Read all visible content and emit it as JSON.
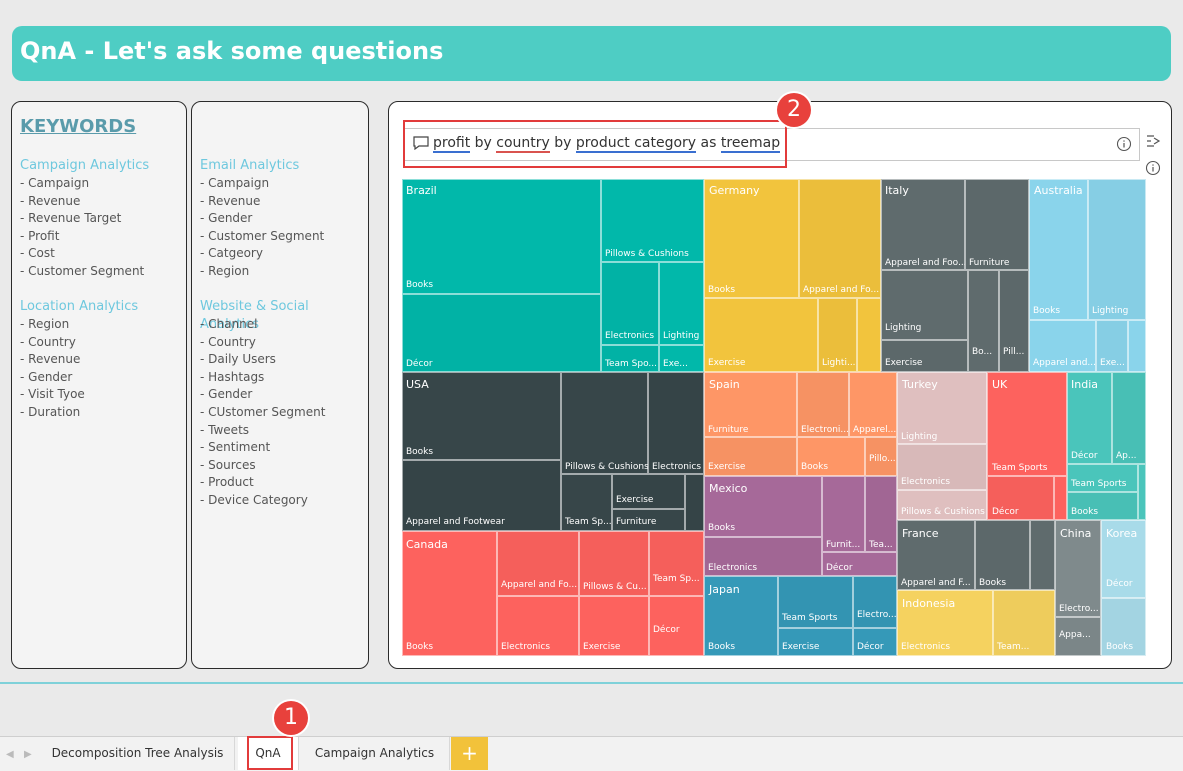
{
  "title": "QnA - Let's ask some questions",
  "keywords_heading": "KEYWORDS",
  "left_groups": [
    {
      "title": "Campaign Analytics",
      "items": [
        "- Campaign",
        "- Revenue",
        "- Revenue Target",
        "- Profit",
        "- Cost",
        "- Customer Segment"
      ]
    },
    {
      "title": "Location Analytics",
      "items": [
        "- Region",
        "- Country",
        "- Revenue",
        "- Gender",
        "- Visit Tyoe",
        "- Duration"
      ]
    }
  ],
  "mid_groups": [
    {
      "title": "Email Analytics",
      "items": [
        "- Campaign",
        "- Revenue",
        "- Gender",
        "- Customer Segment",
        "- Catgeory",
        "- Region"
      ]
    },
    {
      "title": "Website & Social Analytics",
      "items": [
        "- Channel",
        "- Country",
        "- Daily Users",
        "- Hashtags",
        "- Gender",
        "- CUstomer Segment",
        "- Tweets",
        "- Sentiment",
        "- Sources",
        "- Product",
        "- Device Category"
      ]
    }
  ],
  "qna": {
    "words": [
      {
        "t": "profit",
        "u": "blue"
      },
      {
        "t": " by ",
        "u": ""
      },
      {
        "t": "country",
        "u": "red"
      },
      {
        "t": " by ",
        "u": ""
      },
      {
        "t": "product category",
        "u": "blue"
      },
      {
        "t": " as ",
        "u": ""
      },
      {
        "t": "treemap",
        "u": "blue"
      }
    ]
  },
  "badges": {
    "b1": "1",
    "b2": "2"
  },
  "tabs": {
    "decomp": "Decomposition Tree Analysis",
    "qna": "QnA",
    "campaign": "Campaign Analytics",
    "add": "+"
  },
  "colors": {
    "title_bar": "#4ecdc4",
    "badge": "#e8413c",
    "add_tab": "#f2c23a"
  },
  "chart_data": {
    "type": "treemap",
    "hierarchy": [
      "country",
      "product category"
    ],
    "measure": "profit",
    "countries": [
      {
        "name": "Brazil",
        "color": "#01b8aa",
        "labels": [
          "Books",
          "Décor",
          "Pillows & Cushions",
          "Electronics",
          "Lighting",
          "Team Spo...",
          "Exe..."
        ]
      },
      {
        "name": "Germany",
        "color": "#f2c43d",
        "labels": [
          "Books",
          "Apparel and Fo...",
          "Exercise",
          "Lighti..."
        ]
      },
      {
        "name": "Italy",
        "color": "#5f6b6d",
        "labels": [
          "Apparel and Foo...",
          "Furniture",
          "Lighting",
          "Exercise",
          "Bo...",
          "Pill..."
        ]
      },
      {
        "name": "Australia",
        "color": "#8ad4eb",
        "labels": [
          "Books",
          "Lighting",
          "Apparel and...",
          "Exe..."
        ]
      },
      {
        "name": "USA",
        "color": "#374649",
        "labels": [
          "Books",
          "Apparel and Footwear",
          "Pillows & Cushions",
          "Electronics",
          "Exercise",
          "Team Sp...",
          "Furniture"
        ]
      },
      {
        "name": "Spain",
        "color": "#fe9666",
        "labels": [
          "Furniture",
          "Electroni...",
          "Apparel...",
          "Exercise",
          "Books",
          "Pillo..."
        ]
      },
      {
        "name": "Turkey",
        "color": "#dfbfbf",
        "labels": [
          "Lighting",
          "Electronics",
          "Pillows & Cushions"
        ]
      },
      {
        "name": "UK",
        "color": "#fd625e",
        "labels": [
          "Team Sports",
          "Décor"
        ]
      },
      {
        "name": "India",
        "color": "#4ac5bb",
        "labels": [
          "Décor",
          "Ap...",
          "Team Sports",
          "Books"
        ]
      },
      {
        "name": "Mexico",
        "color": "#a66999",
        "labels": [
          "Books",
          "Electronics",
          "Furnit...",
          "Tea...",
          "Décor"
        ]
      },
      {
        "name": "France",
        "color": "#5f6b6d",
        "labels": [
          "Apparel and F...",
          "Books"
        ]
      },
      {
        "name": "China",
        "color": "#7f8a8c",
        "labels": [
          "Electro...",
          "Appa..."
        ]
      },
      {
        "name": "Korea",
        "color": "#a8dbe9",
        "labels": [
          "Décor",
          "Books"
        ]
      },
      {
        "name": "Canada",
        "color": "#fd625e",
        "labels": [
          "Apparel and Fo...",
          "Pillows & Cu...",
          "Team Sp...",
          "Décor",
          "Books",
          "Electronics",
          "Exercise"
        ]
      },
      {
        "name": "Japan",
        "color": "#3599b8",
        "labels": [
          "Team Sports",
          "Electro...",
          "Books",
          "Exercise",
          "Décor"
        ]
      },
      {
        "name": "Indonesia",
        "color": "#f5d25f",
        "labels": [
          "Electronics",
          "Team..."
        ]
      }
    ]
  }
}
